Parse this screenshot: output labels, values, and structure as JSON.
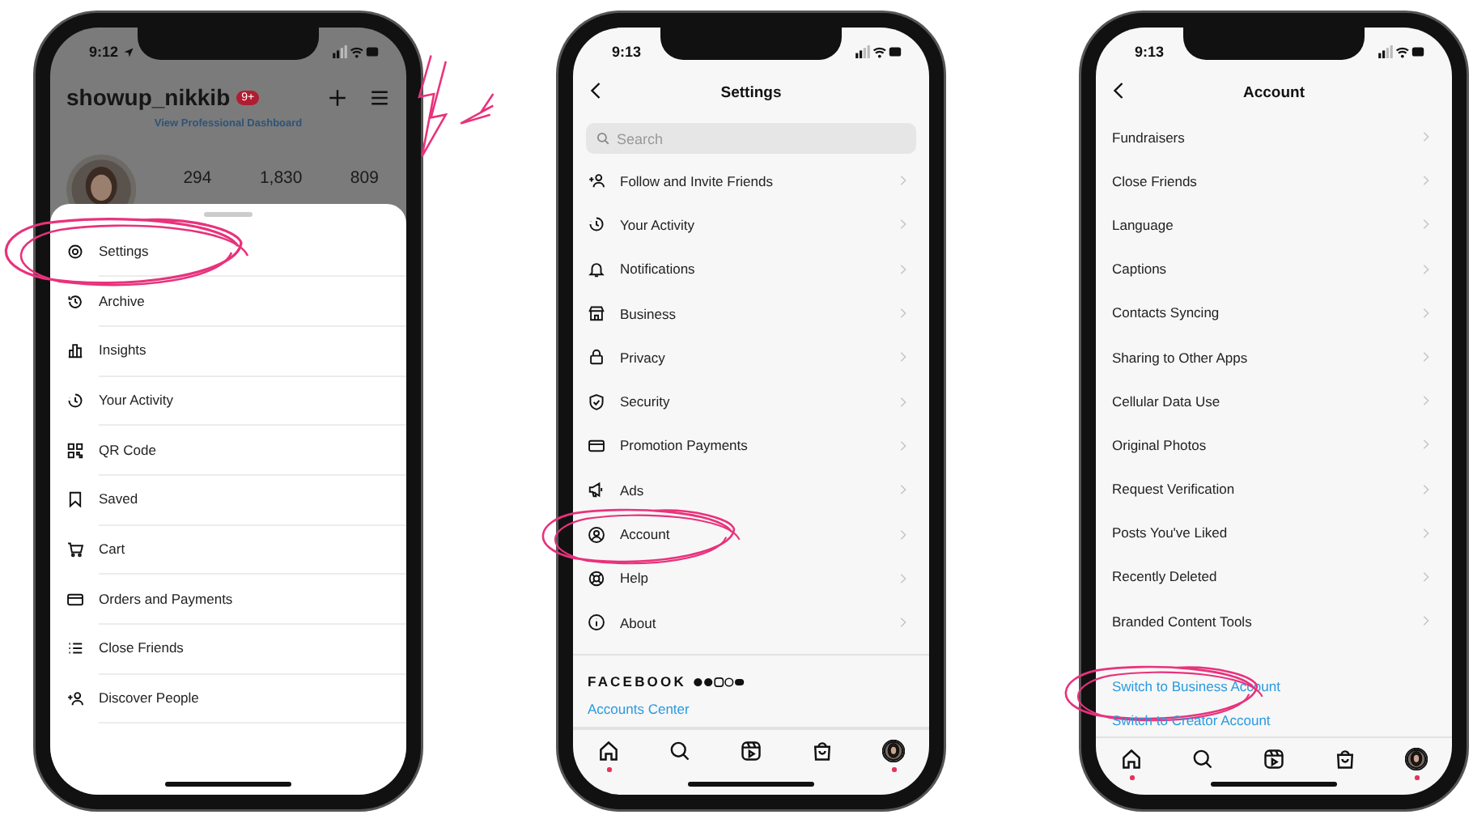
{
  "phones": [
    {
      "kind": "profile_menu",
      "status": {
        "time": "9:12",
        "location": true
      },
      "profile": {
        "username": "showup_nikkib",
        "badge": "9+",
        "dashboard_link": "View Professional Dashboard",
        "stats": [
          "294",
          "1,830",
          "809"
        ]
      },
      "menu": [
        {
          "label": "Settings",
          "kind": "gear",
          "circled": true
        },
        {
          "label": "Archive",
          "kind": "history",
          "circled": false
        },
        {
          "label": "Insights",
          "kind": "chart",
          "circled": false
        },
        {
          "label": "Your Activity",
          "kind": "activity",
          "circled": false
        },
        {
          "label": "QR Code",
          "kind": "qr",
          "circled": false
        },
        {
          "label": "Saved",
          "kind": "bookmark",
          "circled": false
        },
        {
          "label": "Cart",
          "kind": "cart",
          "circled": false
        },
        {
          "label": "Orders and Payments",
          "kind": "card",
          "circled": false
        },
        {
          "label": "Close Friends",
          "kind": "list",
          "circled": false
        },
        {
          "label": "Discover People",
          "kind": "addperson",
          "circled": false
        }
      ]
    },
    {
      "kind": "settings",
      "status": {
        "time": "9:13"
      },
      "title": "Settings",
      "search": {
        "placeholder": "Search"
      },
      "items": [
        {
          "label": "Follow and Invite Friends",
          "kind": "addperson",
          "circled": false
        },
        {
          "label": "Your Activity",
          "kind": "activity",
          "circled": false
        },
        {
          "label": "Notifications",
          "kind": "bell",
          "circled": false
        },
        {
          "label": "Business",
          "kind": "store",
          "circled": false
        },
        {
          "label": "Privacy",
          "kind": "lock",
          "circled": false
        },
        {
          "label": "Security",
          "kind": "shield",
          "circled": false
        },
        {
          "label": "Promotion Payments",
          "kind": "card",
          "circled": false
        },
        {
          "label": "Ads",
          "kind": "megaphone",
          "circled": false
        },
        {
          "label": "Account",
          "kind": "personcircle",
          "circled": true
        },
        {
          "label": "Help",
          "kind": "lifebuoy",
          "circled": false
        },
        {
          "label": "About",
          "kind": "info",
          "circled": false
        }
      ],
      "footer": {
        "brand": "FACEBOOK",
        "link": "Accounts Center"
      },
      "tab_bar": [
        {
          "kind": "home",
          "dot": true
        },
        {
          "kind": "search",
          "dot": false
        },
        {
          "kind": "reels",
          "dot": false
        },
        {
          "kind": "shop",
          "dot": false
        },
        {
          "kind": "profile",
          "dot": true
        }
      ]
    },
    {
      "kind": "account",
      "status": {
        "time": "9:13"
      },
      "title": "Account",
      "items": [
        {
          "label": "Fundraisers",
          "kind": "nav",
          "circled": false
        },
        {
          "label": "Close Friends",
          "kind": "nav",
          "circled": false
        },
        {
          "label": "Language",
          "kind": "nav",
          "circled": false
        },
        {
          "label": "Captions",
          "kind": "nav",
          "circled": false
        },
        {
          "label": "Contacts Syncing",
          "kind": "nav",
          "circled": false
        },
        {
          "label": "Sharing to Other Apps",
          "kind": "nav",
          "circled": false
        },
        {
          "label": "Cellular Data Use",
          "kind": "nav",
          "circled": false
        },
        {
          "label": "Original Photos",
          "kind": "nav",
          "circled": false
        },
        {
          "label": "Request Verification",
          "kind": "nav",
          "circled": false
        },
        {
          "label": "Posts You've Liked",
          "kind": "nav",
          "circled": false
        },
        {
          "label": "Recently Deleted",
          "kind": "nav",
          "circled": false
        },
        {
          "label": "Branded Content Tools",
          "kind": "nav",
          "circled": false
        },
        {
          "label": "Switch to Business Account",
          "kind": "link",
          "circled": true
        },
        {
          "label": "Switch to Creator Account",
          "kind": "link",
          "circled": false
        }
      ],
      "tab_bar": [
        {
          "kind": "home",
          "dot": true
        },
        {
          "kind": "search",
          "dot": false
        },
        {
          "kind": "reels",
          "dot": false
        },
        {
          "kind": "shop",
          "dot": false
        },
        {
          "kind": "profile",
          "dot": true
        }
      ]
    }
  ]
}
